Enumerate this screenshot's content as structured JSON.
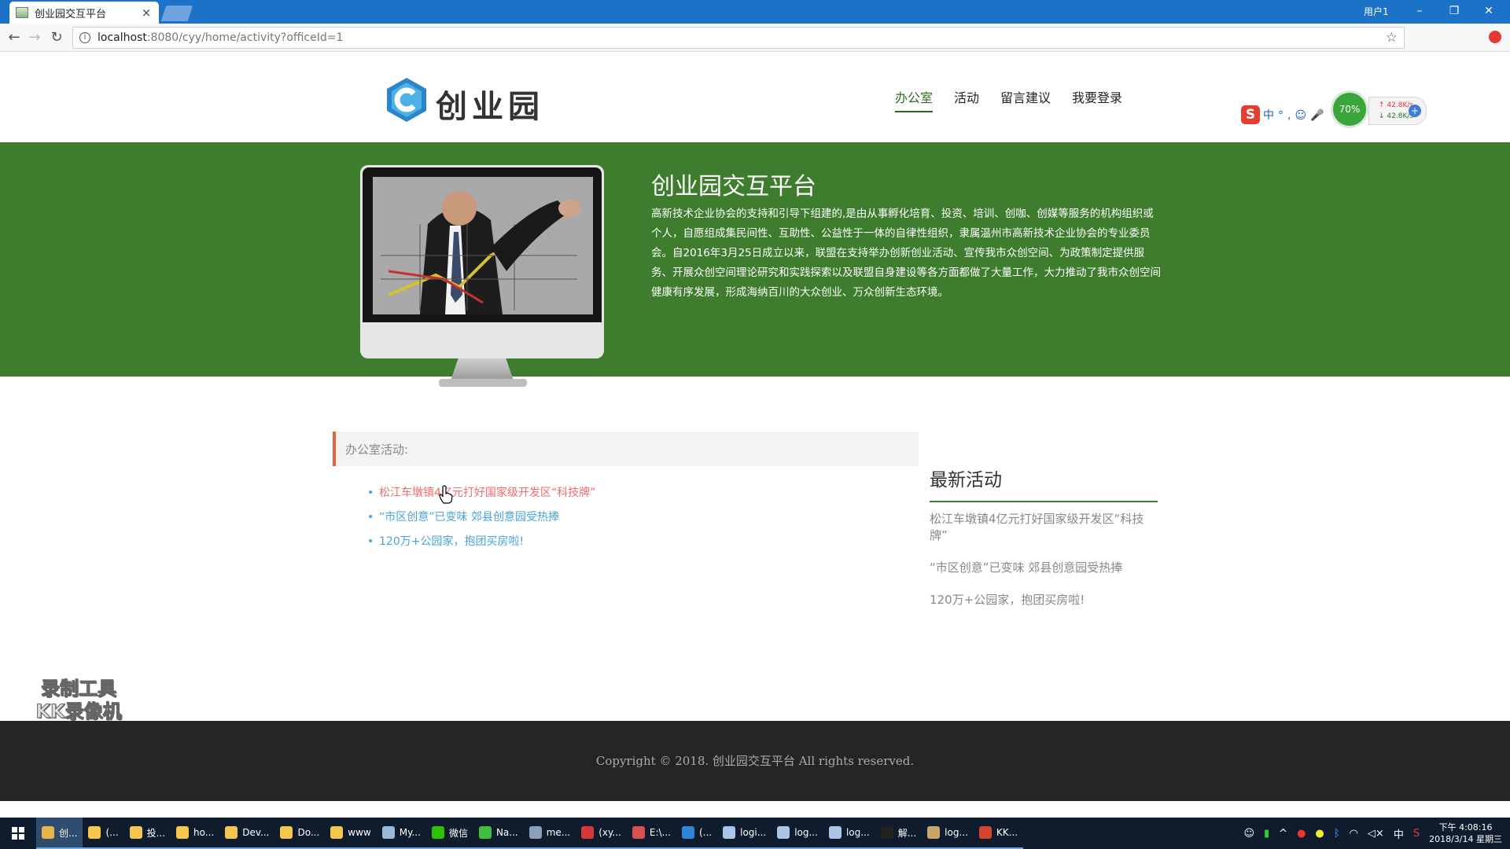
{
  "browser": {
    "tab_title": "创业园交互平台",
    "tab_close": "×",
    "user_label": "用户1",
    "minimize": "–",
    "restore": "❐",
    "close": "✕",
    "back": "←",
    "forward": "→",
    "reload": "↻",
    "url_host": "localhost",
    "url_rest": ":8080/cyy/home/activity?officeId=1",
    "star": "☆"
  },
  "header": {
    "logo_text": "创业园",
    "nav": [
      "办公室",
      "活动",
      "留言建议",
      "我要登录"
    ]
  },
  "ime": {
    "brand": "S",
    "items": "中°,☺🎤",
    "gauge": "70%",
    "up": "↑ 42.8K/s",
    "down": "↓ 42.8K/s",
    "plus": "+"
  },
  "banner": {
    "title": "创业园交互平台",
    "text": "高新技术企业协会的支持和引导下组建的,是由从事孵化培育、投资、培训、创咖、创媒等服务的机构组织或个人，自愿组成集民间性、互助性、公益性于一体的自律性组织，隶属温州市高新技术企业协会的专业委员会。自2016年3月25日成立以来，联盟在支持举办创新创业活动、宣传我市众创空间、为政策制定提供服务、开展众创空间理论研究和实践探索以及联盟自身建设等各方面都做了大量工作，大力推动了我市众创空间健康有序发展，形成海纳百川的大众创业、万众创新生态环境。",
    "apple": ""
  },
  "office": {
    "heading": "办公室活动:",
    "activities": [
      "松江车墩镇4亿元打好国家级开发区“科技牌”",
      "“市区创意”已变味 郊县创意园受热捧",
      "120万+公园家，抱团买房啦!"
    ]
  },
  "latest": {
    "title": "最新活动",
    "items": [
      "松江车墩镇4亿元打好国家级开发区“科技牌”",
      "“市区创意”已变味 郊县创意园受热捧",
      "120万+公园家，抱团买房啦!"
    ]
  },
  "watermark": {
    "line1": "录制工具",
    "line2": "KK录像机"
  },
  "footer": {
    "copyright": "Copyright © 2018. 创业园交互平台 All rights reserved."
  },
  "taskbar": {
    "tasks": [
      {
        "label": "创...",
        "color": "#e8b44a",
        "active": true
      },
      {
        "label": "(...",
        "color": "#f3c64d"
      },
      {
        "label": "投...",
        "color": "#f3c64d"
      },
      {
        "label": "ho...",
        "color": "#f3c64d"
      },
      {
        "label": "Dev...",
        "color": "#f3c64d"
      },
      {
        "label": "Do...",
        "color": "#f3c64d"
      },
      {
        "label": "www",
        "color": "#f3c64d"
      },
      {
        "label": "My...",
        "color": "#9ab8d8"
      },
      {
        "label": "微信",
        "color": "#2dc100"
      },
      {
        "label": "Na...",
        "color": "#3fbf3f"
      },
      {
        "label": "me...",
        "color": "#8aa0b8"
      },
      {
        "label": "(xy...",
        "color": "#d8363a"
      },
      {
        "label": "E:\\...",
        "color": "#d65050"
      },
      {
        "label": "(...",
        "color": "#2f86d9"
      },
      {
        "label": "logi...",
        "color": "#a9c6e8"
      },
      {
        "label": "log...",
        "color": "#a9c6e8"
      },
      {
        "label": "log...",
        "color": "#a9c6e8"
      },
      {
        "label": "解...",
        "color": "#222222"
      },
      {
        "label": "log...",
        "color": "#c9a56a"
      },
      {
        "label": "KK...",
        "color": "#d4452f"
      }
    ],
    "tray_lang": "中",
    "time": "下午 4:08:16",
    "date": "2018/3/14 星期三"
  }
}
